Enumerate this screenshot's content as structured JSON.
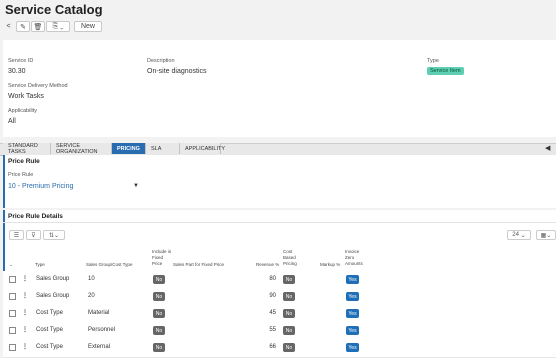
{
  "page": {
    "title": "Service Catalog"
  },
  "toolbar": {
    "back": "<",
    "edit": "✎",
    "delete": "🗑",
    "copy": "⎘ ⌄",
    "new_label": "New"
  },
  "header": {
    "service_id_label": "Service ID",
    "service_id": "30.30",
    "description_label": "Description",
    "description": "On-site diagnostics",
    "type_label": "Type",
    "type": "Service Item",
    "delivery_label": "Service Delivery Method",
    "delivery": "Work Tasks",
    "applicability_label": "Applicability",
    "applicability": "All"
  },
  "tabs": [
    {
      "label": "STANDARD TASKS"
    },
    {
      "label": "SERVICE ORGANIZATION"
    },
    {
      "label": "PRICING"
    },
    {
      "label": "SLA"
    },
    {
      "label": "APPLICABILITY"
    }
  ],
  "price_rule": {
    "section_title": "Price Rule",
    "field_label": "Price Rule",
    "value": "10 - Premium Pricing"
  },
  "details": {
    "section_title": "Price Rule Details",
    "page_size": "24",
    "columns": {
      "type": "Type",
      "group": "Sales Group/Cost Type",
      "include": "Include in Fixed Price",
      "part": "Sales Part for Fixed Price",
      "revenue": "Revenue %",
      "cost_based": "Cost Based Pricing",
      "markup": "Markup %",
      "invoice": "Invoice Zero Amounts"
    },
    "rows": [
      {
        "type": "Sales Group",
        "group": "10",
        "include": "No",
        "revenue": "80",
        "cost_based": "No",
        "invoice": "Yes"
      },
      {
        "type": "Sales Group",
        "group": "20",
        "include": "No",
        "revenue": "90",
        "cost_based": "No",
        "invoice": "Yes"
      },
      {
        "type": "Cost Type",
        "group": "Material",
        "include": "No",
        "revenue": "45",
        "cost_based": "No",
        "invoice": "Yes"
      },
      {
        "type": "Cost Type",
        "group": "Personnel",
        "include": "No",
        "revenue": "55",
        "cost_based": "No",
        "invoice": "Yes"
      },
      {
        "type": "Cost Type",
        "group": "External",
        "include": "No",
        "revenue": "66",
        "cost_based": "No",
        "invoice": "Yes"
      }
    ]
  },
  "colors": {
    "accent": "#2a6cb0",
    "badge": "#5fcfb4",
    "yes": "#1e6fb8",
    "no": "#666666"
  }
}
